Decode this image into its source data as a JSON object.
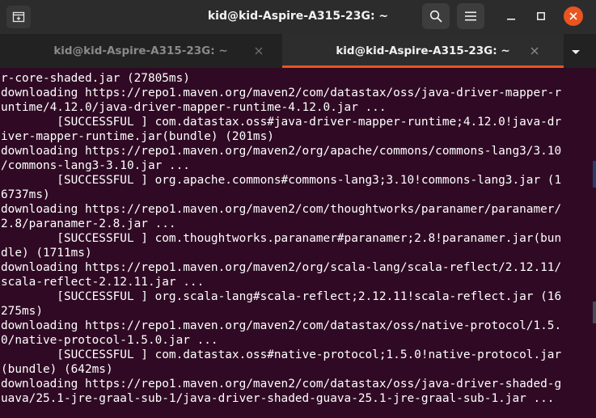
{
  "window": {
    "title": "kid@kid-Aspire-A315-23G: ~",
    "accent_color": "#e95420",
    "background_color": "#300a24"
  },
  "header_buttons": {
    "new_tab_icon": "new-tab-icon",
    "search_icon": "search-icon",
    "menu_icon": "hamburger-menu-icon",
    "minimize_icon": "minimize-icon",
    "maximize_icon": "maximize-icon",
    "close_icon": "close-icon"
  },
  "tabs": [
    {
      "label": "kid@kid-Aspire-A315-23G: ~",
      "active": false
    },
    {
      "label": "kid@kid-Aspire-A315-23G: ~",
      "active": true
    }
  ],
  "terminal": {
    "lines": [
      "r-core-shaded.jar (27805ms)",
      "downloading https://repo1.maven.org/maven2/com/datastax/oss/java-driver-mapper-r",
      "untime/4.12.0/java-driver-mapper-runtime-4.12.0.jar ...",
      "        [SUCCESSFUL ] com.datastax.oss#java-driver-mapper-runtime;4.12.0!java-dr",
      "iver-mapper-runtime.jar(bundle) (201ms)",
      "downloading https://repo1.maven.org/maven2/org/apache/commons/commons-lang3/3.10",
      "/commons-lang3-3.10.jar ...",
      "        [SUCCESSFUL ] org.apache.commons#commons-lang3;3.10!commons-lang3.jar (1",
      "6737ms)",
      "downloading https://repo1.maven.org/maven2/com/thoughtworks/paranamer/paranamer/",
      "2.8/paranamer-2.8.jar ...",
      "        [SUCCESSFUL ] com.thoughtworks.paranamer#paranamer;2.8!paranamer.jar(bun",
      "dle) (1711ms)",
      "downloading https://repo1.maven.org/maven2/org/scala-lang/scala-reflect/2.12.11/",
      "scala-reflect-2.12.11.jar ...",
      "        [SUCCESSFUL ] org.scala-lang#scala-reflect;2.12.11!scala-reflect.jar (16",
      "275ms)",
      "downloading https://repo1.maven.org/maven2/com/datastax/oss/native-protocol/1.5.",
      "0/native-protocol-1.5.0.jar ...",
      "        [SUCCESSFUL ] com.datastax.oss#native-protocol;1.5.0!native-protocol.jar",
      "(bundle) (642ms)",
      "downloading https://repo1.maven.org/maven2/com/datastax/oss/java-driver-shaded-g",
      "uava/25.1-jre-graal-sub-1/java-driver-shaded-guava-25.1-jre-graal-sub-1.jar ..."
    ]
  }
}
